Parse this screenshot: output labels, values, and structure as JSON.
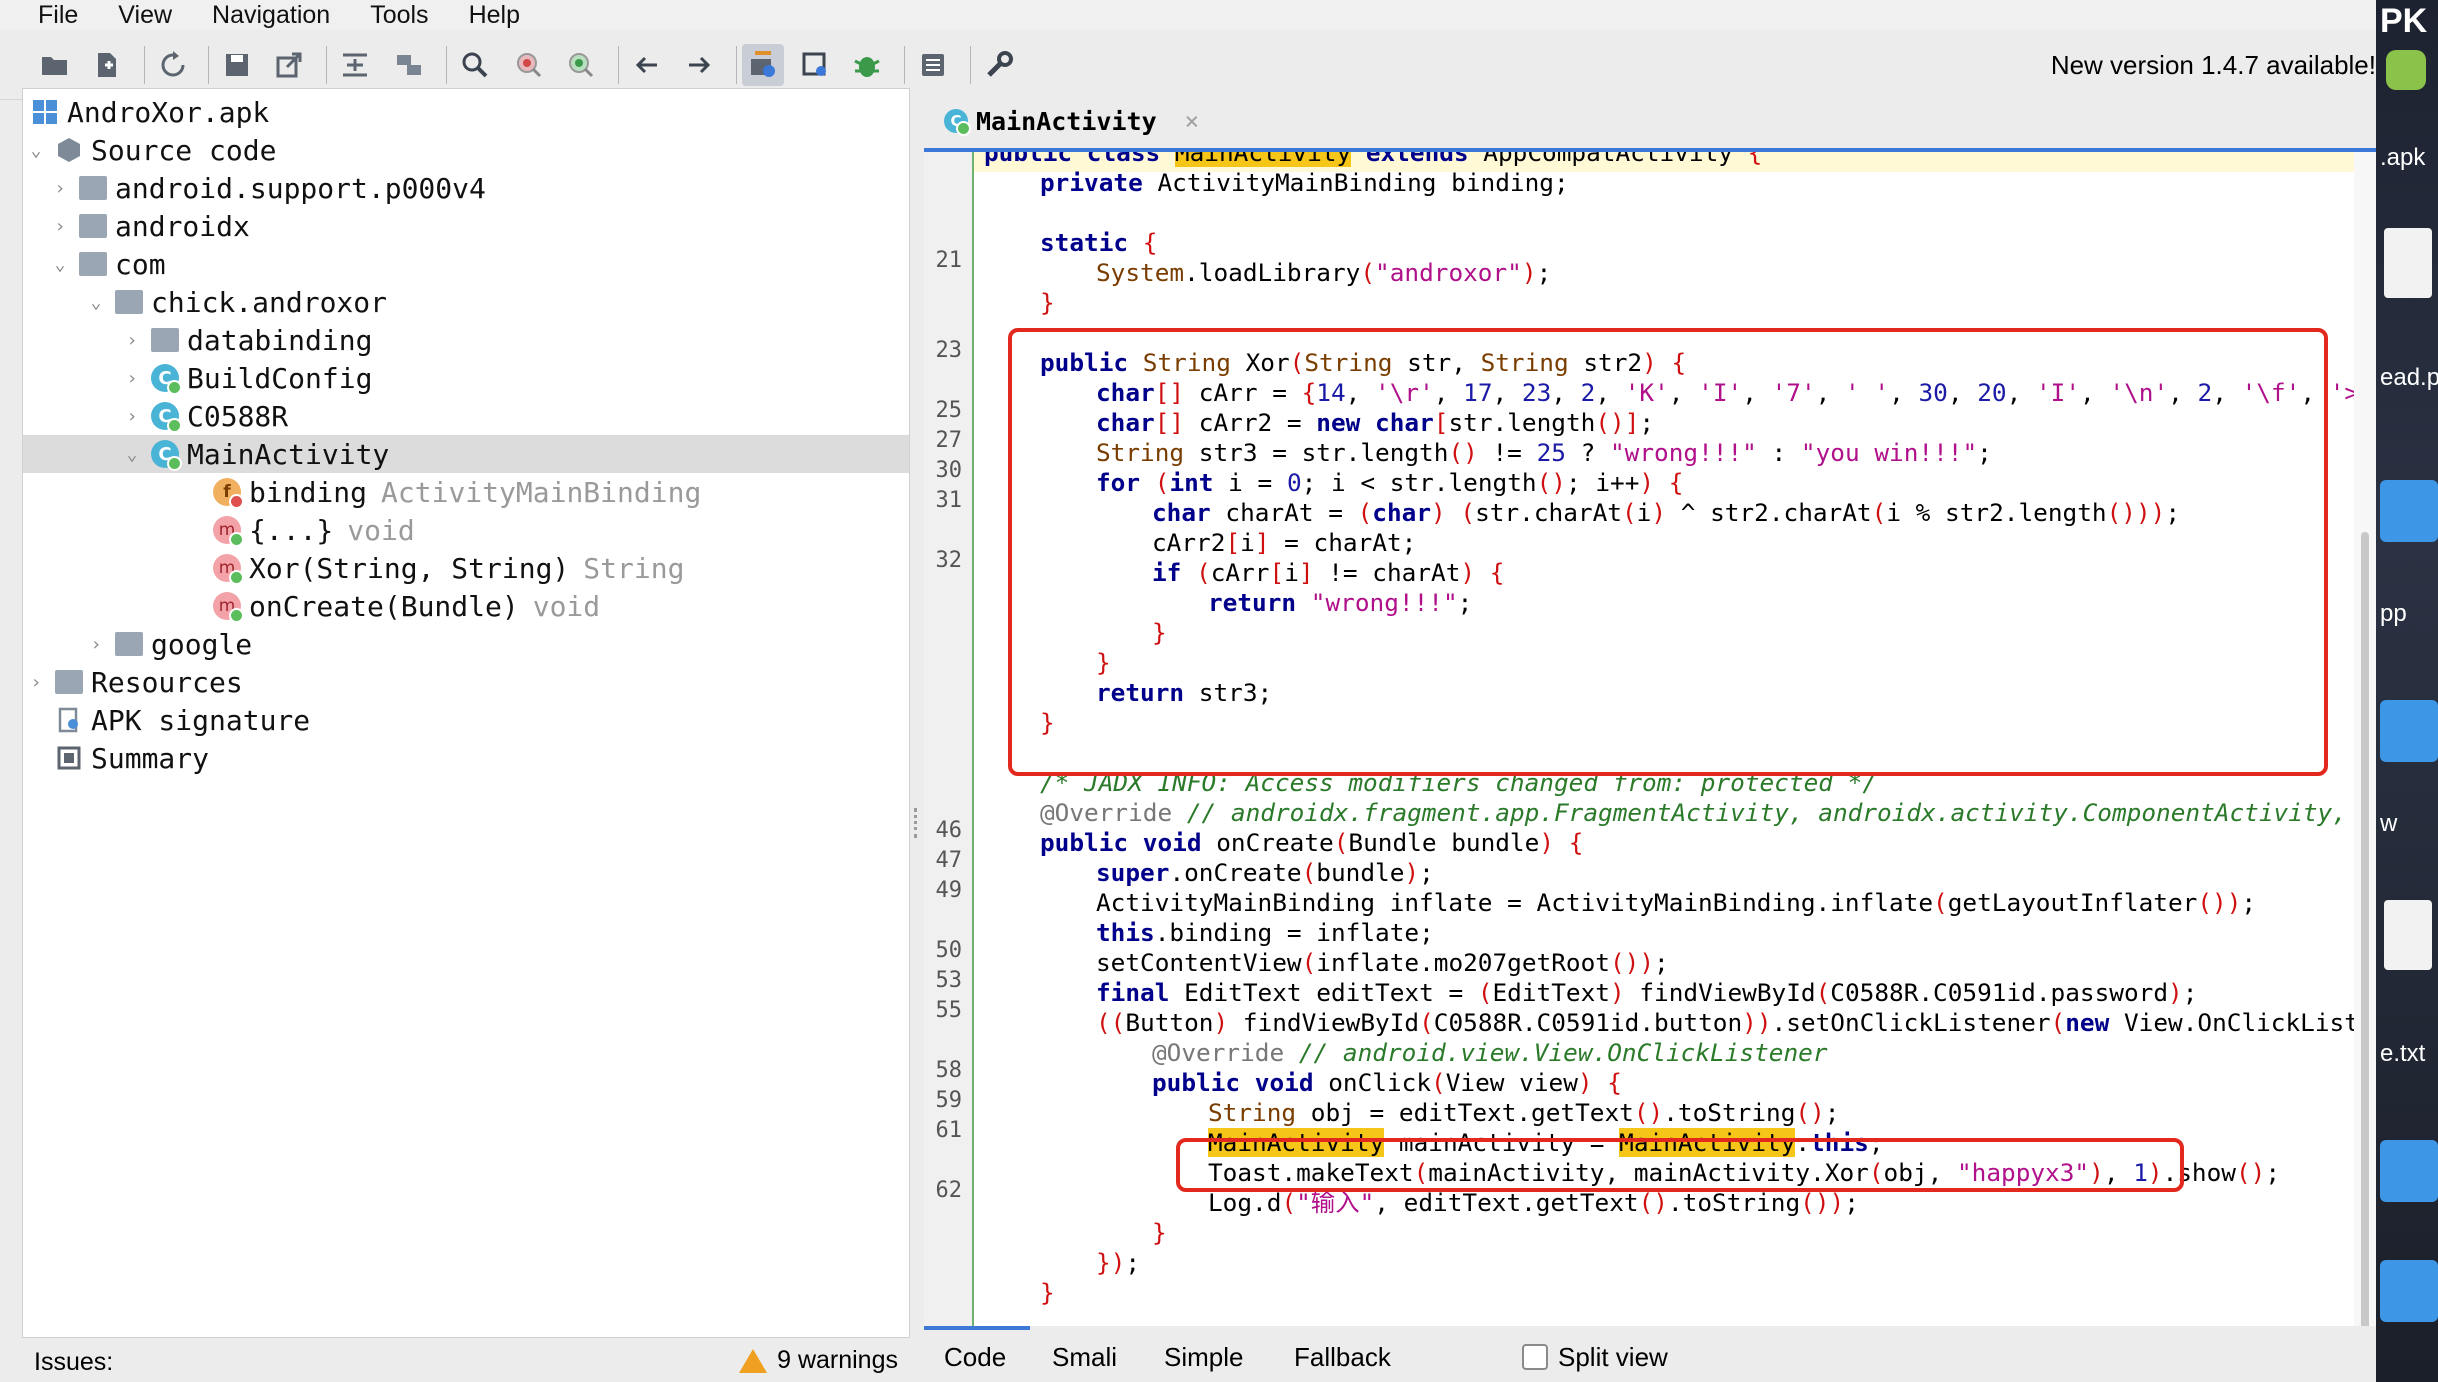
{
  "menu": [
    "File",
    "View",
    "Navigation",
    "Tools",
    "Help"
  ],
  "toolbar": {
    "new_version": "New version 1.4.7 available!",
    "icons": [
      "open-file",
      "add-files",
      "sync",
      "save",
      "export",
      "unfold",
      "tree-view",
      "search",
      "find-class",
      "find-usage",
      "back",
      "forward",
      "decompile-settings",
      "deobfuscation",
      "debug",
      "log",
      "preferences"
    ]
  },
  "tree": {
    "root": "AndroXor.apk",
    "source_code": "Source code",
    "pkg_android_support": "android.support.p000v4",
    "pkg_androidx": "androidx",
    "pkg_com": "com",
    "pkg_chick": "chick.androxor",
    "pkg_databinding": "databinding",
    "cls_buildconfig": "BuildConfig",
    "cls_c0588r": "C0588R",
    "cls_mainactivity": "MainActivity",
    "field_binding": "binding",
    "field_binding_type": "ActivityMainBinding",
    "method_init": "{...}",
    "method_init_type": "void",
    "method_xor": "Xor(String, String)",
    "method_xor_type": "String",
    "method_oncreate": "onCreate(Bundle)",
    "method_oncreate_type": "void",
    "pkg_google": "google",
    "resources": "Resources",
    "apk_signature": "APK signature",
    "summary": "Summary"
  },
  "issues": {
    "label": "Issues:",
    "warnings": "9 warnings"
  },
  "editor": {
    "tab": "MainActivity",
    "tab_close": "×",
    "line_numbers": {
      "l21": "21",
      "l23": "23",
      "l25": "25",
      "l27": "27",
      "l30": "30",
      "l31": "31",
      "l32": "32",
      "l46": "46",
      "l47": "47",
      "l49": "49",
      "l50": "50",
      "l53": "53",
      "l55": "55",
      "l58": "58",
      "l59": "59",
      "l61": "61",
      "l62": "62"
    }
  },
  "bottom_tabs": {
    "code": "Code",
    "smali": "Smali",
    "simple": "Simple",
    "fallback": "Fallback",
    "split_view": "Split view"
  },
  "desktop": {
    "apk": ".apk",
    "ead": "ead.p",
    "pp": "pp",
    "w": "w",
    "txt": "e.txt",
    "pk": "PK"
  },
  "colors": {
    "accent": "#3b78d8",
    "highlight_box": "#e3281e",
    "keyword": "#00008b",
    "string": "#b0108a"
  }
}
